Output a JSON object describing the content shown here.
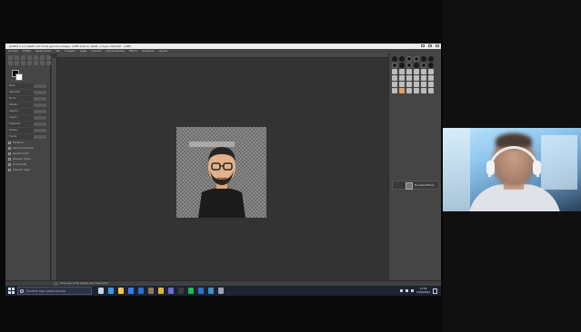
{
  "window": {
    "title": "[GIMP] 1.2.3 (RGB color 8-bit gamma integer, GIMP built-in sRGB, 1 layer) 99x100 – GIMP"
  },
  "menubar": [
    "Archivo",
    "Editar",
    "Seleccionar",
    "Ver",
    "Imagen",
    "Capa",
    "Colores",
    "Herramientas",
    "Filtros",
    "Ventanas",
    "Ayuda"
  ],
  "tool_options": {
    "title": "Opciones de herramienta",
    "rows": [
      "Modo",
      "Opacidad",
      "Pincel",
      "Tamaño",
      "Aspecto",
      "Ángulo",
      "Espaciado",
      "Dureza",
      "Fuerza"
    ],
    "checks": [
      "Dinámica",
      "Aplicar fluctuación",
      "Suavizar trazo",
      "Bloquear pincel",
      "Incremental",
      "Expandir capas"
    ]
  },
  "layers_panel": {
    "header": "Capas",
    "layer_name": "Mi avatar Bitmoji"
  },
  "statusbar": {
    "zoom": "200 %",
    "text": "Pulse para pintar (Mayús para línea recta)"
  },
  "taskbar": {
    "search_placeholder": "Escribe aquí para buscar",
    "time": "11:34",
    "date": "17/03/2021",
    "apps": [
      {
        "name": "task-view",
        "color": "#c9d1e0"
      },
      {
        "name": "edge",
        "color": "#3b9be0"
      },
      {
        "name": "explorer",
        "color": "#f3c34a"
      },
      {
        "name": "store",
        "color": "#3b7de0"
      },
      {
        "name": "mail",
        "color": "#2c72c8"
      },
      {
        "name": "gimp",
        "color": "#8a7a60"
      },
      {
        "name": "chrome",
        "color": "#e2b33a"
      },
      {
        "name": "teams",
        "color": "#6b6fd6"
      },
      {
        "name": "obs",
        "color": "#3c3c3c"
      },
      {
        "name": "spotify",
        "color": "#1db954"
      },
      {
        "name": "word",
        "color": "#2b6fd1"
      },
      {
        "name": "photos",
        "color": "#3a8fd0"
      },
      {
        "name": "gimp-active",
        "color": "#9aa3b5"
      }
    ]
  },
  "webcam": {
    "label": "participant-video"
  }
}
